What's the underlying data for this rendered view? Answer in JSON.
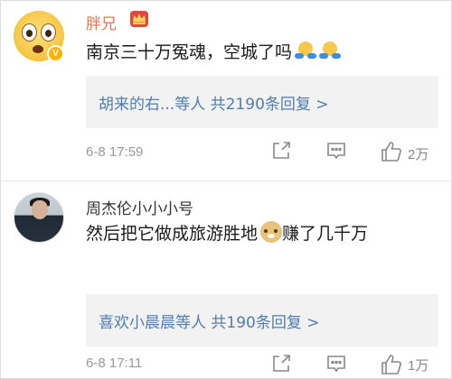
{
  "comments": [
    {
      "username": "胖兄",
      "content": "南京三十万冤魂，空城了吗",
      "reply_summary": "胡来的右...等人 共2190条回复 >",
      "time": "6-8 17:59",
      "likes": "2万",
      "avatar_icon": "surprised-face-emoji",
      "badge_icon": "crown-icon",
      "inline_emojis": [
        "hug-emoji",
        "hug-emoji"
      ]
    },
    {
      "username": "周杰伦小小小号",
      "content": "然后把它做成旅游胜地",
      "content_tail": "赚了几千万",
      "reply_summary": "喜欢小晨晨等人 共190条回复 >",
      "time": "6-8 17:11",
      "likes": "1万",
      "avatar_icon": "user-photo",
      "inline_emojis": [
        "doge-emoji"
      ]
    }
  ],
  "colors": {
    "vip_username": "#eb7350",
    "link_blue": "#507daf",
    "meta_gray": "#999999",
    "reply_bg": "#f2f2f2"
  }
}
